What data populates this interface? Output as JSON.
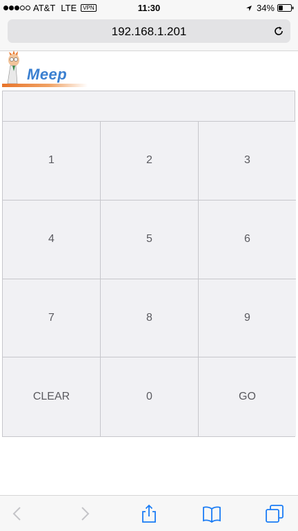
{
  "status_bar": {
    "carrier": "AT&T",
    "network": "LTE",
    "vpn": "VPN",
    "time": "11:30",
    "battery": "34%",
    "battery_level": 0.34,
    "signal_bars_filled": 3,
    "signal_bars_total": 5
  },
  "browser": {
    "url": "192.168.1.201",
    "reload_icon": "reload-icon"
  },
  "page": {
    "logo_text": "Meep",
    "display_value": "",
    "keypad": {
      "keys": [
        "1",
        "2",
        "3",
        "4",
        "5",
        "6",
        "7",
        "8",
        "9",
        "CLEAR",
        "0",
        "GO"
      ]
    }
  },
  "toolbar": {
    "icons": [
      "back-icon",
      "forward-icon",
      "share-icon",
      "bookmarks-icon",
      "tabs-icon"
    ]
  },
  "colors": {
    "accent": "#1a7cf5",
    "logo_blue": "#3a7fd0",
    "logo_orange": "#e8742a",
    "key_background": "#f1f1f4",
    "key_border": "#c6c6cb",
    "key_text": "#5a5a5f"
  }
}
